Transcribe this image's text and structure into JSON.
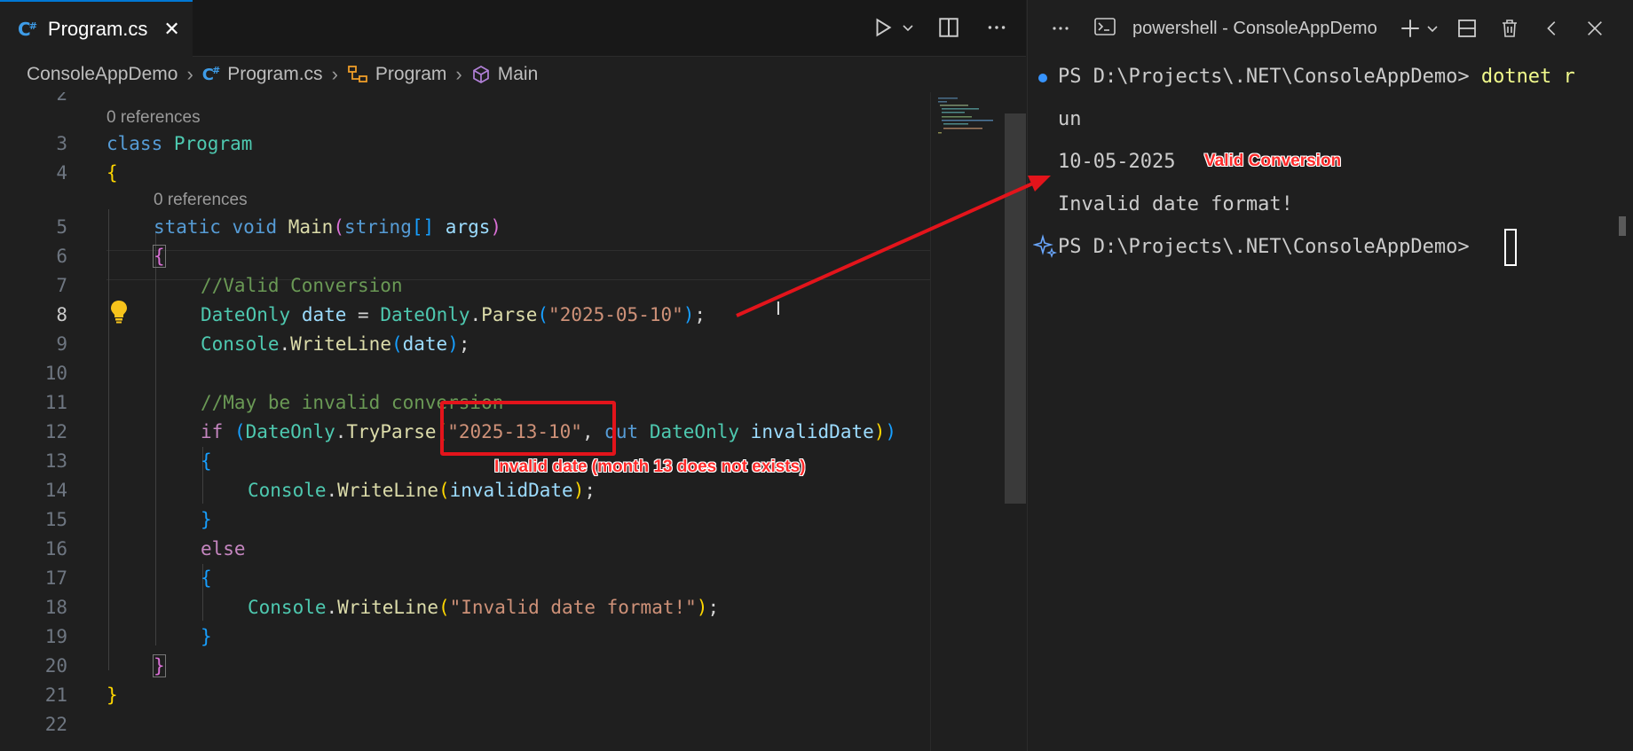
{
  "editor": {
    "tab": {
      "label": "Program.cs",
      "icon": "csharp-file-icon",
      "close": "✕"
    },
    "toolbar": {
      "run": "run-icon",
      "split": "split-editor-icon",
      "more": "more-actions-icon"
    },
    "breadcrumb": [
      {
        "label": "ConsoleAppDemo",
        "icon": ""
      },
      {
        "label": "Program.cs",
        "icon": "csharp-file-icon"
      },
      {
        "label": "Program",
        "icon": "class-icon"
      },
      {
        "label": "Main",
        "icon": "method-cube-icon"
      }
    ],
    "codelens_class": "0 references",
    "codelens_method": "0 references",
    "active_line": "8",
    "line_numbers": [
      "2",
      "3",
      "4",
      "5",
      "6",
      "7",
      "8",
      "9",
      "10",
      "11",
      "12",
      "13",
      "14",
      "15",
      "16",
      "17",
      "18",
      "19",
      "20",
      "21",
      "22"
    ]
  },
  "terminal": {
    "title": "powershell - ConsoleAppDemo",
    "lines": {
      "l1_prompt": "PS D:\\Projects\\.NET\\ConsoleAppDemo> ",
      "l1_cmd": "dotnet r",
      "l2": "un",
      "l3": "10-05-2025",
      "l4": "Invalid date format!",
      "l5_prompt": "PS D:\\Projects\\.NET\\ConsoleAppDemo> "
    }
  },
  "annotations": {
    "valid": "Valid Conversion",
    "invalid": "Invalid date (month 13 does not exists)",
    "color": "#e3141b"
  },
  "colors": {
    "accent": "#0078d4",
    "background": "#1f1f1f"
  }
}
